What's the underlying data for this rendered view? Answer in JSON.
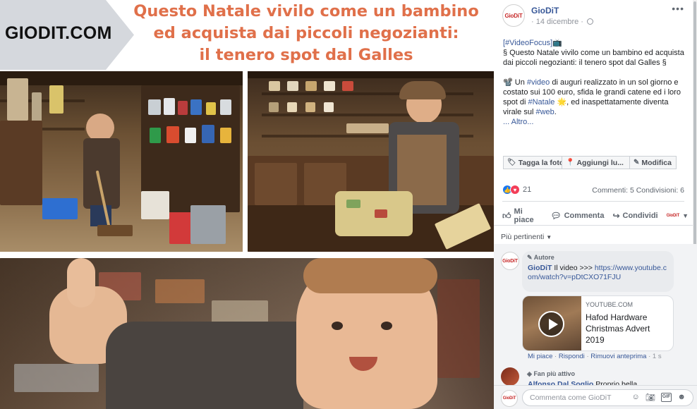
{
  "banner": {
    "logo": "GIODIT.COM",
    "headline": [
      "Questo Natale vivilo come un bambino",
      "ed acquista dai piccoli negozianti:",
      "il tenero spot dal Galles"
    ]
  },
  "post": {
    "page_logo": "GioDiT",
    "author": "GioDiT",
    "date": "· 14 dicembre ·",
    "menu": "•••",
    "body": {
      "line1": "[#VideoFocus]📺",
      "line2": "§ Questo Natale vivilo come un bambino ed acquista dai piccoli negozianti: il tenero spot dal Galles §",
      "p3_a": "📽️ Un ",
      "p3_hash1": "#video",
      "p3_b": " di auguri realizzato in un sol giorno e costato sui 100 euro, sfida le grandi catene ed i loro spot di ",
      "p3_hash2": "#Natale",
      "p3_c": " 🌟, ed inaspettatamente diventa virale sul ",
      "p3_hash3": "#web",
      "p3_d": ".",
      "more": "... Altro..."
    },
    "photo_actions": {
      "tag": "Tagga la foto",
      "location": "Aggiungi lu...",
      "edit": "Modifica"
    },
    "reactions": {
      "count": "21",
      "like_color": "#1877f2",
      "love_color": "#f33e58"
    },
    "stats": "Commenti: 5  Condivisioni: 6",
    "actions": {
      "like": "Mi piace",
      "comment": "Commenta",
      "share": "Condividi"
    },
    "relevance": "Più pertinenti"
  },
  "comments": [
    {
      "badge": "Autore",
      "author": "GioDiT",
      "text": " Il video >>> ",
      "link": "https://www.youtube.com/watch?v=pDtCXO71FJU",
      "card": {
        "domain": "YOUTUBE.COM",
        "title": "Hafod Hardware Christmas Advert 2019"
      },
      "actions": {
        "like": "Mi piace",
        "reply": "Rispondi",
        "remove": "Rimuovi anteprima",
        "time": "1 s"
      }
    },
    {
      "badge": "Fan più attivo",
      "author": "Alfonso Dal Soglio",
      "text": " Proprio bella"
    }
  ],
  "composer": {
    "placeholder": "Commenta come GioDiT"
  },
  "colors": {
    "headline": "#e0704a",
    "link": "#385898",
    "logo_chevron": "#d5d8dd"
  }
}
